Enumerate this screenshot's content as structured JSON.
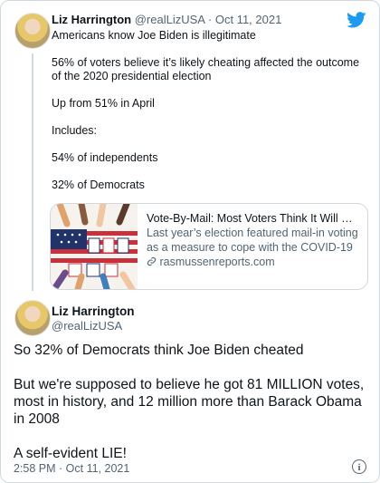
{
  "quoted": {
    "name": "Liz Harrington",
    "handle": "@realLizUSA",
    "separator": "·",
    "date": "Oct 11, 2021",
    "lines": [
      "Americans know Joe Biden is illegitimate",
      "56% of voters believe it’s likely cheating affected the outcome of the 2020 presidential election",
      "Up from 51% in April",
      "Includes:",
      "54% of independents",
      "32% of Democrats"
    ],
    "card": {
      "title": "Vote-By-Mail: Most Voters Think It Will Cau...",
      "description": "Last year’s election featured mail-in voting as a measure to cope with the COVID-19 ...",
      "domain": "rasmussenreports.com",
      "image_icon": "vote-by-mail-collage"
    }
  },
  "main": {
    "name": "Liz Harrington",
    "handle": "@realLizUSA",
    "text": "So 32% of Democrats think Joe Biden cheated\n\nBut we're supposed to believe he got 81 MILLION votes, most in history, and 12 million more than Barack Obama in 2008\n\nA self-evident LIE!",
    "timestamp": "2:58 PM · Oct 11, 2021"
  },
  "colors": {
    "brand": "#1d9bf0",
    "muted": "#536471",
    "text": "#0f1419",
    "border": "#cfd9de"
  },
  "icons": [
    "twitter-bird-icon",
    "link-icon",
    "info-icon"
  ]
}
